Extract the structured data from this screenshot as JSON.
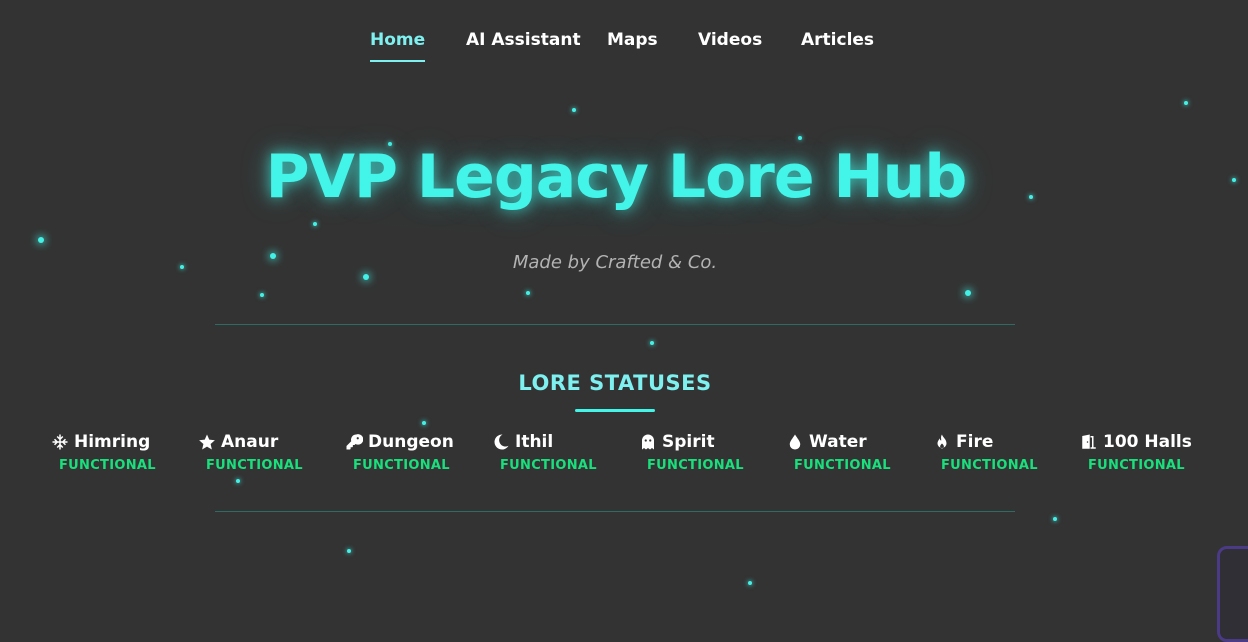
{
  "nav": {
    "items": [
      {
        "label": "Home",
        "active": true
      },
      {
        "label": "AI Assistant",
        "active": false
      },
      {
        "label": "Maps",
        "active": false
      },
      {
        "label": "Videos",
        "active": false
      },
      {
        "label": "Articles",
        "active": false
      }
    ]
  },
  "hero": {
    "title": "PVP Legacy Lore Hub",
    "subtitle": "Made by Crafted & Co."
  },
  "lore": {
    "heading": "LORE STATUSES",
    "items": [
      {
        "icon": "snowflake-icon",
        "name": "Himring",
        "status": "FUNCTIONAL"
      },
      {
        "icon": "star-icon",
        "name": "Anaur",
        "status": "FUNCTIONAL"
      },
      {
        "icon": "key-icon",
        "name": "Dungeon",
        "status": "FUNCTIONAL"
      },
      {
        "icon": "moon-icon",
        "name": "Ithil",
        "status": "FUNCTIONAL"
      },
      {
        "icon": "ghost-icon",
        "name": "Spirit",
        "status": "FUNCTIONAL"
      },
      {
        "icon": "water-drop-icon",
        "name": "Water",
        "status": "FUNCTIONAL"
      },
      {
        "icon": "fire-icon",
        "name": "Fire",
        "status": "FUNCTIONAL"
      },
      {
        "icon": "door-icon",
        "name": "100 Halls",
        "status": "FUNCTIONAL"
      }
    ]
  },
  "colors": {
    "background": "#333333",
    "accent": "#43f4e8",
    "nav_active": "#7ff0f0",
    "status_ok": "#19e07d"
  }
}
